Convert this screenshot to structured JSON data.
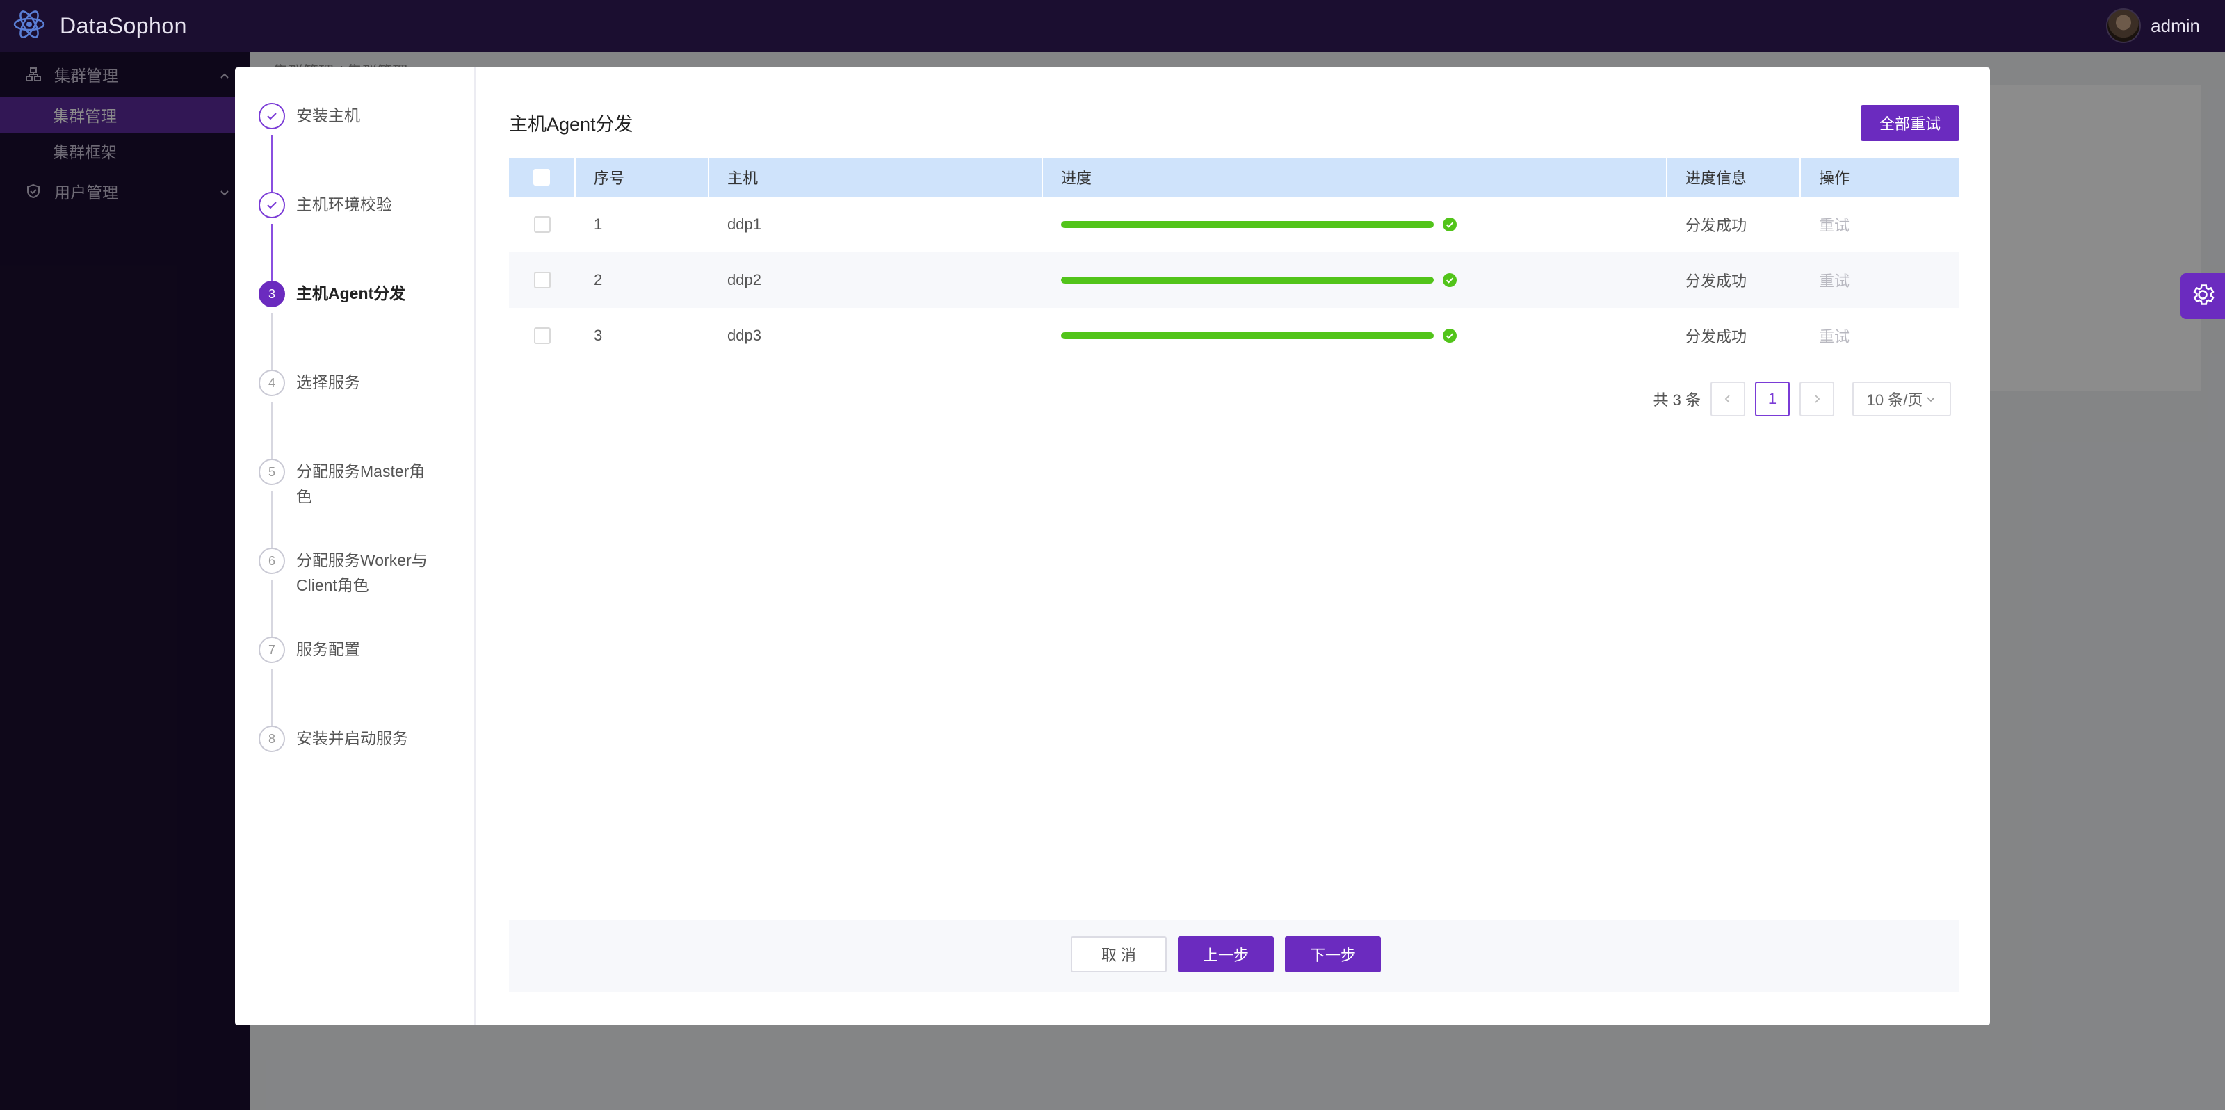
{
  "app": {
    "title": "DataSophon",
    "user": "admin"
  },
  "breadcrumb": "集群管理 / 集群管理",
  "sidebar": {
    "groups": [
      {
        "label": "集群管理",
        "items": [
          {
            "label": "集群管理",
            "active": true
          },
          {
            "label": "集群框架",
            "active": false
          }
        ]
      },
      {
        "label": "用户管理",
        "items": []
      }
    ]
  },
  "steps": [
    {
      "num": "1",
      "label": "安装主机",
      "state": "done"
    },
    {
      "num": "2",
      "label": "主机环境校验",
      "state": "done"
    },
    {
      "num": "3",
      "label": "主机Agent分发",
      "state": "current"
    },
    {
      "num": "4",
      "label": "选择服务",
      "state": "pending"
    },
    {
      "num": "5",
      "label": "分配服务Master角色",
      "state": "pending"
    },
    {
      "num": "6",
      "label": "分配服务Worker与Client角色",
      "state": "pending"
    },
    {
      "num": "7",
      "label": "服务配置",
      "state": "pending"
    },
    {
      "num": "8",
      "label": "安装并启动服务",
      "state": "pending"
    }
  ],
  "panel": {
    "title": "主机Agent分发",
    "retry_all": "全部重试",
    "columns": {
      "idx": "序号",
      "host": "主机",
      "progress": "进度",
      "info": "进度信息",
      "op": "操作"
    },
    "rows": [
      {
        "idx": "1",
        "host": "ddp1",
        "progress": 100,
        "info": "分发成功",
        "op": "重试"
      },
      {
        "idx": "2",
        "host": "ddp2",
        "progress": 100,
        "info": "分发成功",
        "op": "重试"
      },
      {
        "idx": "3",
        "host": "ddp3",
        "progress": 100,
        "info": "分发成功",
        "op": "重试"
      }
    ],
    "pager": {
      "total": "共 3 条",
      "current": "1",
      "size": "10 条/页"
    }
  },
  "footer": {
    "cancel": "取 消",
    "prev": "上一步",
    "next": "下一步"
  },
  "colors": {
    "brand": "#6b2bbf",
    "success": "#52c41a",
    "header_bg": "#1b0e30"
  },
  "icons": [
    "atom-logo-icon",
    "cluster-icon",
    "shield-icon",
    "chevron-up-icon",
    "chevron-down-icon",
    "gear-icon",
    "check-icon",
    "success-check-icon",
    "chevron-left-icon",
    "chevron-right-icon"
  ]
}
